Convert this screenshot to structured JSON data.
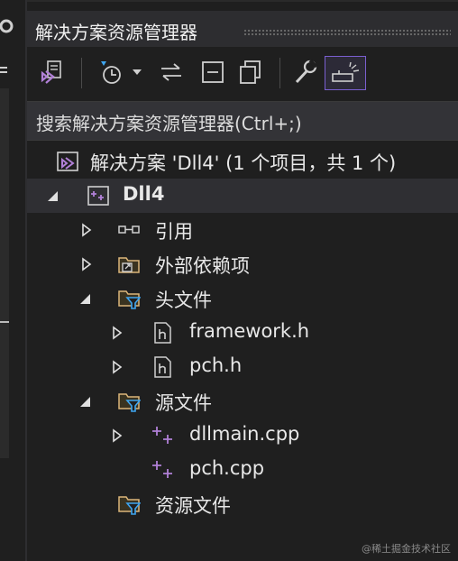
{
  "panel": {
    "title": "解决方案资源管理器"
  },
  "search": {
    "placeholder": "搜索解决方案资源管理器(Ctrl+;)"
  },
  "toolbar": {
    "buttons": [
      {
        "icon": "vs-home-icon"
      },
      {
        "icon": "history-icon"
      },
      {
        "icon": "dropdown-icon"
      },
      {
        "icon": "sync-icon"
      },
      {
        "icon": "collapse-all-icon"
      },
      {
        "icon": "show-all-files-icon"
      },
      {
        "icon": "properties-wrench-icon"
      },
      {
        "icon": "preview-selected-icon",
        "active": true
      }
    ]
  },
  "tree": {
    "solution": "解决方案 'Dll4' (1 个项目，共 1 个)",
    "project": "Dll4",
    "references": "引用",
    "external": "外部依赖项",
    "headers": "头文件",
    "header_files": [
      "framework.h",
      "pch.h"
    ],
    "sources": "源文件",
    "source_files": [
      "dllmain.cpp",
      "pch.cpp"
    ],
    "resources": "资源文件"
  },
  "watermark": "@稀土掘金技术社区",
  "colors": {
    "accent": "#b180d7",
    "filter": "#3ea6f0",
    "folder": "#dcb67a",
    "active_border": "#7a5fd0"
  }
}
